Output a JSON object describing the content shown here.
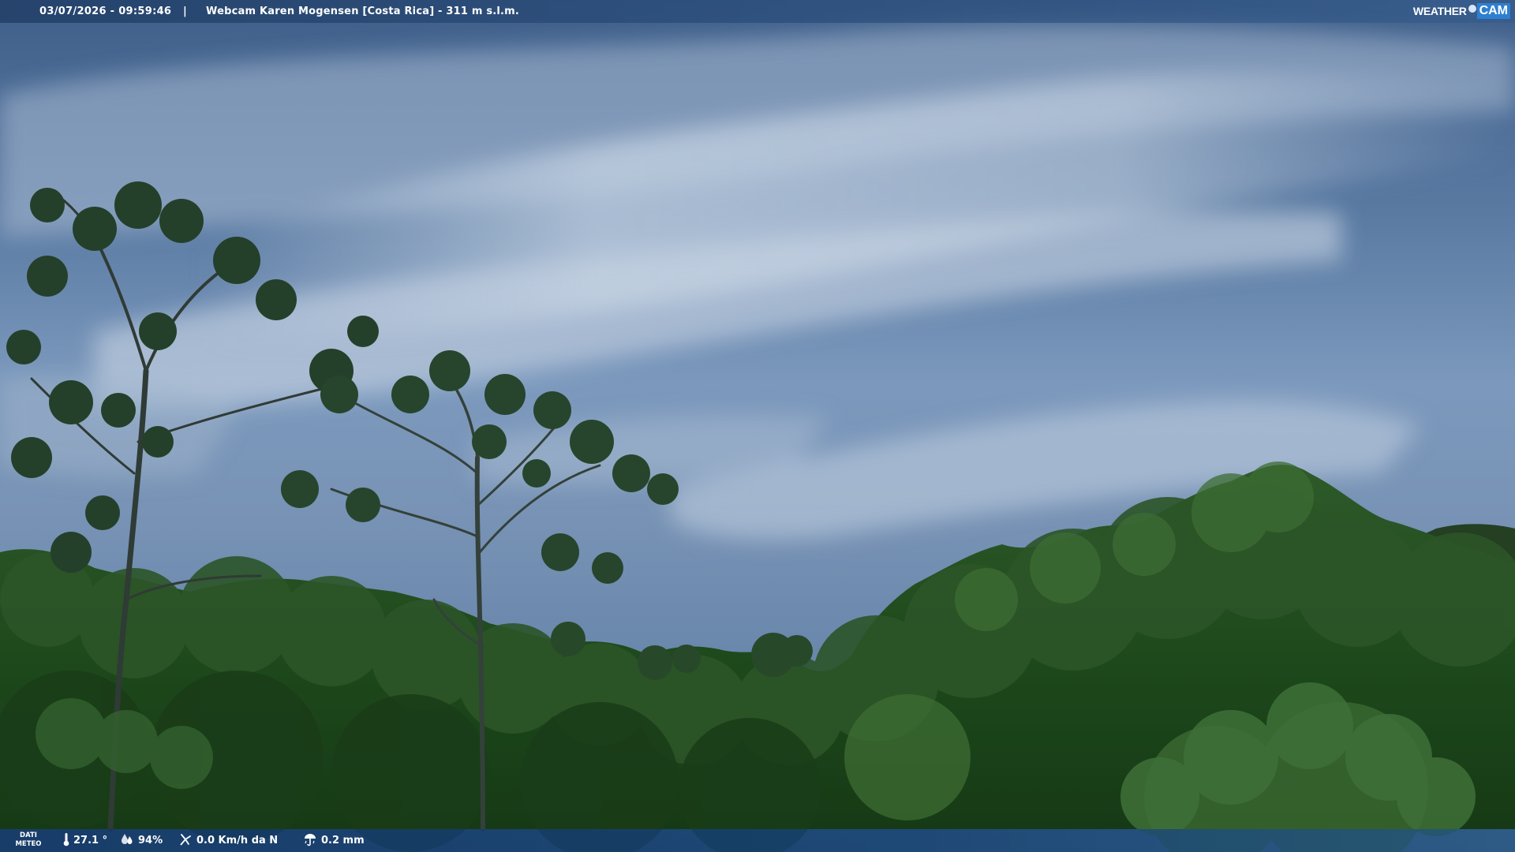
{
  "header": {
    "datetime": "03/07/2026 - 09:59:46",
    "separator": "|",
    "title": "Webcam Karen Mogensen [Costa Rica]  - 311 m s.l.m."
  },
  "logo": {
    "word": "WEATHER",
    "cam": "CAM"
  },
  "footer": {
    "label_line1": "DATI",
    "label_line2": "METEO",
    "temperature": "27.1 °",
    "humidity": "94%",
    "wind": "0.0 Km/h da N",
    "rain": "0.2 mm",
    "icons": {
      "temperature": "thermometer-icon",
      "humidity": "humidity-drop-icon",
      "wind": "wind-icon",
      "rain": "rain-umbrella-icon"
    }
  },
  "colors": {
    "bar_bg": "#1f4a7a",
    "text": "#ffffff",
    "cam_accent": "#2e7fd0"
  }
}
